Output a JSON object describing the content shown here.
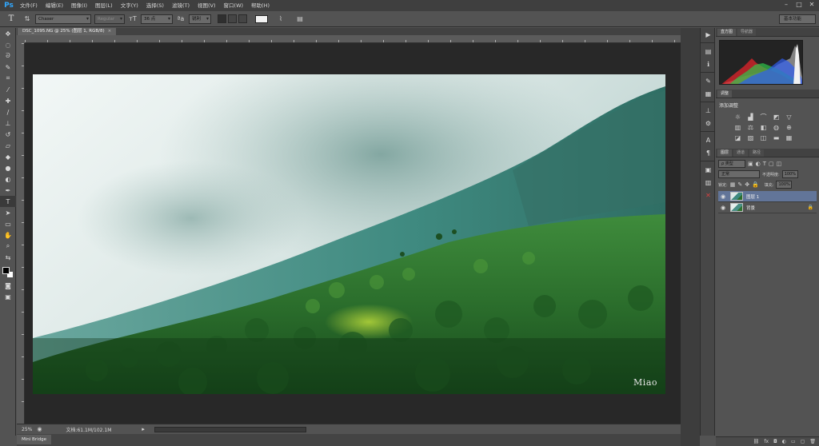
{
  "app": {
    "logo": "Ps"
  },
  "menu": [
    "文件(F)",
    "编辑(E)",
    "图像(I)",
    "图层(L)",
    "文字(Y)",
    "选择(S)",
    "滤镜(T)",
    "视图(V)",
    "窗口(W)",
    "帮助(H)"
  ],
  "window_controls": [
    "–",
    "□",
    "✕"
  ],
  "options": {
    "tool_glyph": "T",
    "font_family": "Chaser",
    "font_style": "Regular",
    "font_size": "36 点",
    "antialias": "锐利",
    "workspace": "基本功能"
  },
  "document": {
    "tab_title": "DSC_1095.NG @ 25% (图层 1, RGB/8)",
    "tab_close": "×",
    "watermark": "Miao"
  },
  "status": {
    "zoom": "25%",
    "doc_info": "文档:61.1M/102.1M",
    "arrow": "▸"
  },
  "mini_bridge": {
    "label": "Mini Bridge"
  },
  "panels": {
    "histogram_tabs": [
      "直方图",
      "导航器"
    ],
    "adjustments_tabs": [
      "调整"
    ],
    "adjustments_title": "添加调整",
    "layers_tabs": [
      "图层",
      "通道",
      "路径"
    ],
    "layers_filter": "ρ 类型",
    "blend_mode": "正常",
    "opacity_label": "不透明度:",
    "opacity_value": "100%",
    "lock_label": "锁定:",
    "fill_label": "填充:",
    "fill_value": "100%",
    "layers": [
      {
        "name": "图层 1",
        "selected": true
      },
      {
        "name": "背景",
        "selected": false,
        "locked": true
      }
    ]
  },
  "colors": {
    "accent": "#627599",
    "ps_blue": "#31a8ff",
    "close_red": "#d64040"
  }
}
